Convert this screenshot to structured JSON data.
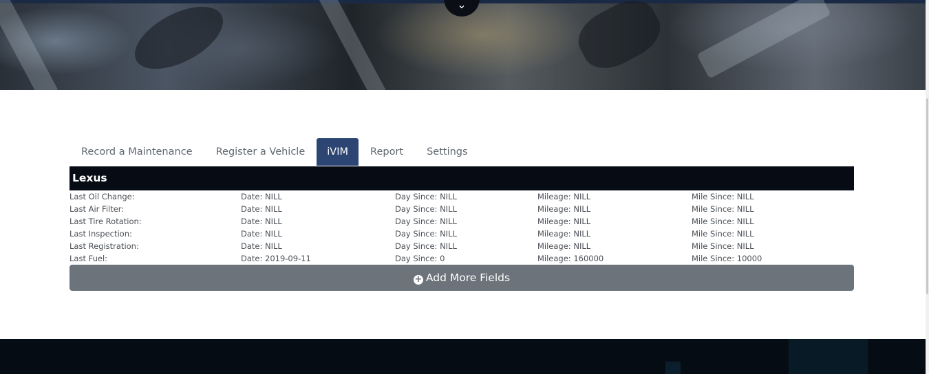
{
  "tabs": [
    {
      "label": "Record a Maintenance",
      "active": false
    },
    {
      "label": "Register a Vehicle",
      "active": false
    },
    {
      "label": "iVIM",
      "active": true
    },
    {
      "label": "Report",
      "active": false
    },
    {
      "label": "Settings",
      "active": false
    }
  ],
  "vehicle": {
    "name": "Lexus",
    "rows": [
      {
        "label": "Last Oil Change:",
        "date": "Date: NILL",
        "day_since": "Day Since: NILL",
        "mileage": "Mileage: NILL",
        "mile_since": "Mile Since: NILL"
      },
      {
        "label": "Last Air Filter:",
        "date": "Date: NILL",
        "day_since": "Day Since: NILL",
        "mileage": "Mileage: NILL",
        "mile_since": "Mile Since: NILL"
      },
      {
        "label": "Last Tire Rotation:",
        "date": "Date: NILL",
        "day_since": "Day Since: NILL",
        "mileage": "Mileage: NILL",
        "mile_since": "Mile Since: NILL"
      },
      {
        "label": "Last Inspection:",
        "date": "Date: NILL",
        "day_since": "Day Since: NILL",
        "mileage": "Mileage: NILL",
        "mile_since": "Mile Since: NILL"
      },
      {
        "label": "Last Registration:",
        "date": "Date: NILL",
        "day_since": "Day Since: NILL",
        "mileage": "Mileage: NILL",
        "mile_since": "Mile Since: NILL"
      },
      {
        "label": "Last Fuel:",
        "date": "Date: 2019-09-11",
        "day_since": "Day Since: 0",
        "mileage": "Mileage: 160000",
        "mile_since": "Mile Since: 10000"
      }
    ]
  },
  "add_button": {
    "label": "Add More Fields",
    "icon": "plus-circle-icon"
  },
  "hero": {
    "scroll_icon": "chevron-down-icon"
  },
  "colors": {
    "tab_active_bg": "#2d4573",
    "card_header_bg": "#060b14",
    "add_button_bg": "#6c737a",
    "footer_bg": "#060c14"
  }
}
